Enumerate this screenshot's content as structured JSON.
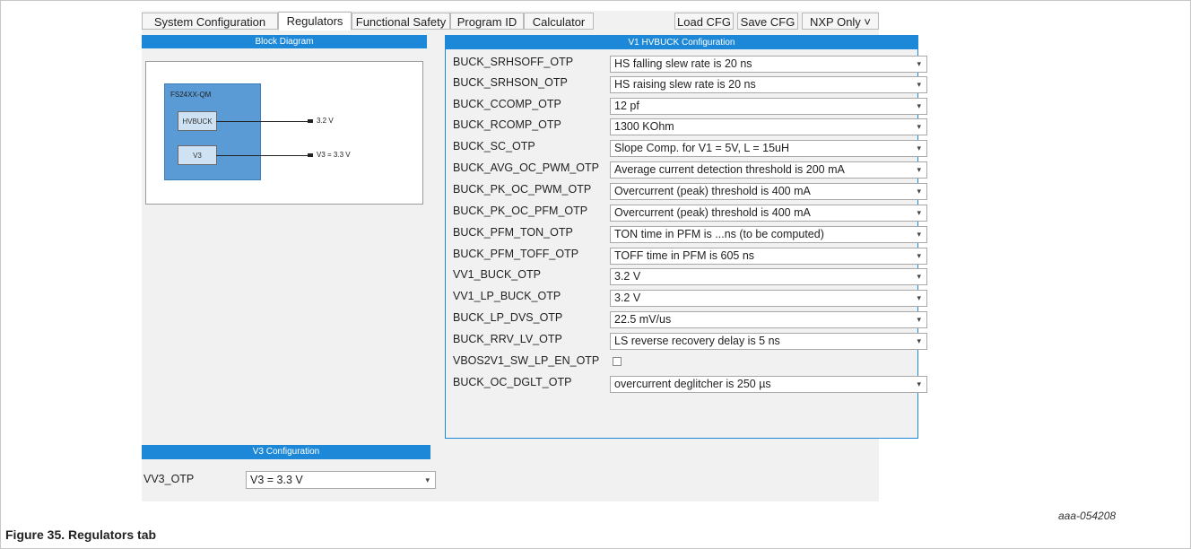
{
  "tabs": [
    "System Configuration",
    "Regulators",
    "Functional Safety",
    "Program ID",
    "Calculator"
  ],
  "active_tab": "Regulators",
  "toolbar": {
    "load": "Load CFG",
    "save": "Save CFG",
    "nxp": "NXP Only ˅"
  },
  "block_diagram": {
    "title": "Block Diagram",
    "chip": "FS24XX-QM",
    "blocks": [
      {
        "name": "HVBUCK",
        "output": "3.2 V"
      },
      {
        "name": "V3",
        "output": "V3 = 3.3 V"
      }
    ]
  },
  "v1_panel": {
    "title": "V1 HVBUCK Configuration",
    "rows": [
      {
        "label": "BUCK_SRHSOFF_OTP",
        "value": "HS falling slew rate is 20 ns"
      },
      {
        "label": "BUCK_SRHSON_OTP",
        "value": "HS raising slew rate is 20 ns"
      },
      {
        "label": "BUCK_CCOMP_OTP",
        "value": "12 pf"
      },
      {
        "label": "BUCK_RCOMP_OTP",
        "value": "1300 KOhm"
      },
      {
        "label": "BUCK_SC_OTP",
        "value": "Slope Comp. for V1 = 5V, L = 15uH"
      },
      {
        "label": "BUCK_AVG_OC_PWM_OTP",
        "value": "Average current detection threshold is 200 mA"
      },
      {
        "label": "BUCK_PK_OC_PWM_OTP",
        "value": "Overcurrent (peak) threshold is 400 mA"
      },
      {
        "label": "BUCK_PK_OC_PFM_OTP",
        "value": "Overcurrent (peak) threshold is 400 mA"
      },
      {
        "label": "BUCK_PFM_TON_OTP",
        "value": "TON time in PFM is ...ns (to be computed)"
      },
      {
        "label": "BUCK_PFM_TOFF_OTP",
        "value": "TOFF time in PFM is 605 ns"
      },
      {
        "label": "VV1_BUCK_OTP",
        "value": "3.2 V"
      },
      {
        "label": "VV1_LP_BUCK_OTP",
        "value": "3.2 V"
      },
      {
        "label": "BUCK_LP_DVS_OTP",
        "value": "22.5 mV/us"
      },
      {
        "label": "BUCK_RRV_LV_OTP",
        "value": "LS reverse recovery delay is 5 ns"
      },
      {
        "label": "VBOS2V1_SW_LP_EN_OTP",
        "value": ""
      },
      {
        "label": "BUCK_OC_DGLT_OTP",
        "value": "overcurrent deglitcher is 250 µs"
      }
    ]
  },
  "v3_panel": {
    "title": "V3 Configuration",
    "label": "VV3_OTP",
    "value": "V3 = 3.3 V"
  },
  "figure": {
    "ref": "aaa-054208",
    "caption": "Figure 35.  Regulators tab"
  },
  "colors": {
    "accent": "#1e88d8",
    "chip": "#5b9bd5",
    "block": "#cfe2f3"
  }
}
